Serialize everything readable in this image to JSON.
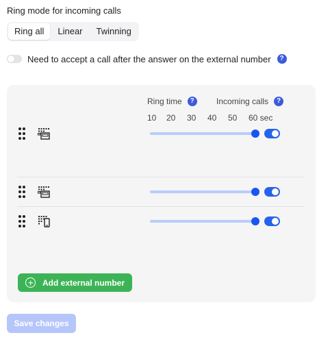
{
  "ring_mode": {
    "title": "Ring mode for incoming calls",
    "options": [
      "Ring all",
      "Linear",
      "Twinning"
    ],
    "selected": "Ring all"
  },
  "accept_option": {
    "label": "Need to accept a call after the answer on the external number",
    "enabled": false,
    "help_icon": "question-circle-icon"
  },
  "panel": {
    "ring_time_label": "Ring time",
    "incoming_calls_label": "Incoming calls",
    "ticks": [
      "10",
      "20",
      "30",
      "40",
      "50",
      "60 sec"
    ],
    "ring_time_range": [
      10,
      60
    ],
    "rows": [
      {
        "device_icon": "desk-phone-icon",
        "ring_time_sec": 60,
        "incoming_calls_enabled": true
      },
      {
        "device_icon": "desk-phone-icon",
        "ring_time_sec": 60,
        "incoming_calls_enabled": true
      },
      {
        "device_icon": "desk-phone-mobile-icon",
        "ring_time_sec": 60,
        "incoming_calls_enabled": true
      }
    ]
  },
  "buttons": {
    "add_external": "Add external number",
    "save": "Save changes",
    "save_enabled": false
  },
  "colors": {
    "accent": "#2563eb",
    "help": "#3b5bdb",
    "slider_track": "#b9ccfb",
    "add_button": "#3cb455",
    "save_disabled": "#b6c6fb",
    "panel_bg": "#f5f5f6"
  }
}
